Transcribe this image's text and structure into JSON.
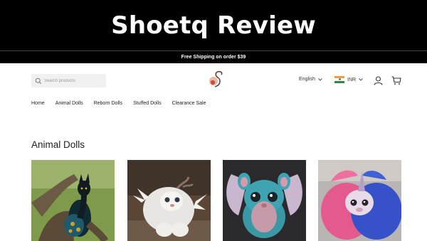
{
  "banner": {
    "title": "Shoetq Review"
  },
  "announcement": {
    "text": "Free Shipping on order $39"
  },
  "header": {
    "search_placeholder": "Search products",
    "language": "English",
    "currency": "INR"
  },
  "nav": {
    "items": [
      {
        "label": "Home"
      },
      {
        "label": "Animal Dolls"
      },
      {
        "label": "Reborn Dolls"
      },
      {
        "label": "Stuffed Dolls"
      },
      {
        "label": "Clearance Sale"
      }
    ]
  },
  "main": {
    "section_title": "Animal Dolls",
    "products": [
      {
        "image": "black-peacock-cat-doll"
      },
      {
        "image": "white-furry-horned-creature-doll"
      },
      {
        "image": "teal-winged-fairy-creature-doll"
      },
      {
        "image": "pink-blue-unicorn-creature-doll"
      }
    ]
  },
  "colors": {
    "banner_bg": "#000000",
    "search_bg": "#f1f1f1",
    "text": "#222222"
  },
  "icons": [
    "search-icon",
    "logo",
    "chevron-down-icon",
    "india-flag-icon",
    "account-icon",
    "cart-icon"
  ]
}
